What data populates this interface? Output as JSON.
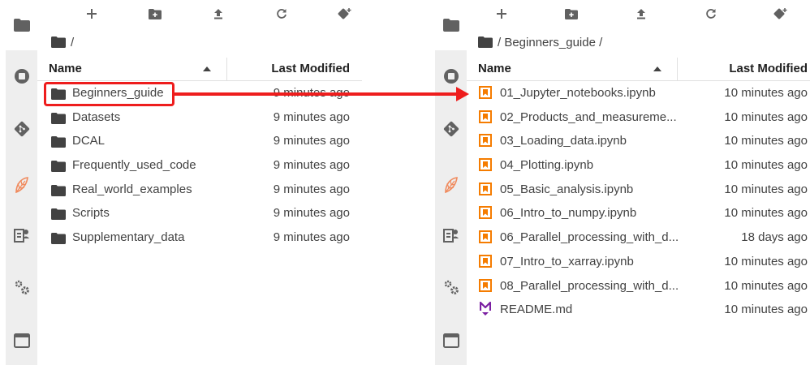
{
  "left": {
    "breadcrumb": "/",
    "header": {
      "name": "Name",
      "last_modified": "Last Modified"
    },
    "items": [
      {
        "name": "Beginners_guide",
        "modified": "9 minutes ago"
      },
      {
        "name": "Datasets",
        "modified": "9 minutes ago"
      },
      {
        "name": "DCAL",
        "modified": "9 minutes ago"
      },
      {
        "name": "Frequently_used_code",
        "modified": "9 minutes ago"
      },
      {
        "name": "Real_world_examples",
        "modified": "9 minutes ago"
      },
      {
        "name": "Scripts",
        "modified": "9 minutes ago"
      },
      {
        "name": "Supplementary_data",
        "modified": "9 minutes ago"
      }
    ]
  },
  "right": {
    "breadcrumb": "/ Beginners_guide /",
    "header": {
      "name": "Name",
      "last_modified": "Last Modified"
    },
    "items": [
      {
        "name": "01_Jupyter_notebooks.ipynb",
        "modified": "10 minutes ago"
      },
      {
        "name": "02_Products_and_measureme...",
        "modified": "10 minutes ago"
      },
      {
        "name": "03_Loading_data.ipynb",
        "modified": "10 minutes ago"
      },
      {
        "name": "04_Plotting.ipynb",
        "modified": "10 minutes ago"
      },
      {
        "name": "05_Basic_analysis.ipynb",
        "modified": "10 minutes ago"
      },
      {
        "name": "06_Intro_to_numpy.ipynb",
        "modified": "10 minutes ago"
      },
      {
        "name": "06_Parallel_processing_with_d...",
        "modified": "18 days ago"
      },
      {
        "name": "07_Intro_to_xarray.ipynb",
        "modified": "10 minutes ago"
      },
      {
        "name": "08_Parallel_processing_with_d...",
        "modified": "10 minutes ago"
      },
      {
        "name": "README.md",
        "modified": "10 minutes ago"
      }
    ]
  },
  "icons": {
    "folder": "folder-icon",
    "notebook": "notebook-icon",
    "markdown": "markdown-icon"
  },
  "colors": {
    "notebook_orange": "#f57c00",
    "markdown_purple": "#7b1fa2",
    "annotation_red": "#ee1d1d",
    "icon_gray": "#616161",
    "activity_bg": "#eeeeee"
  }
}
